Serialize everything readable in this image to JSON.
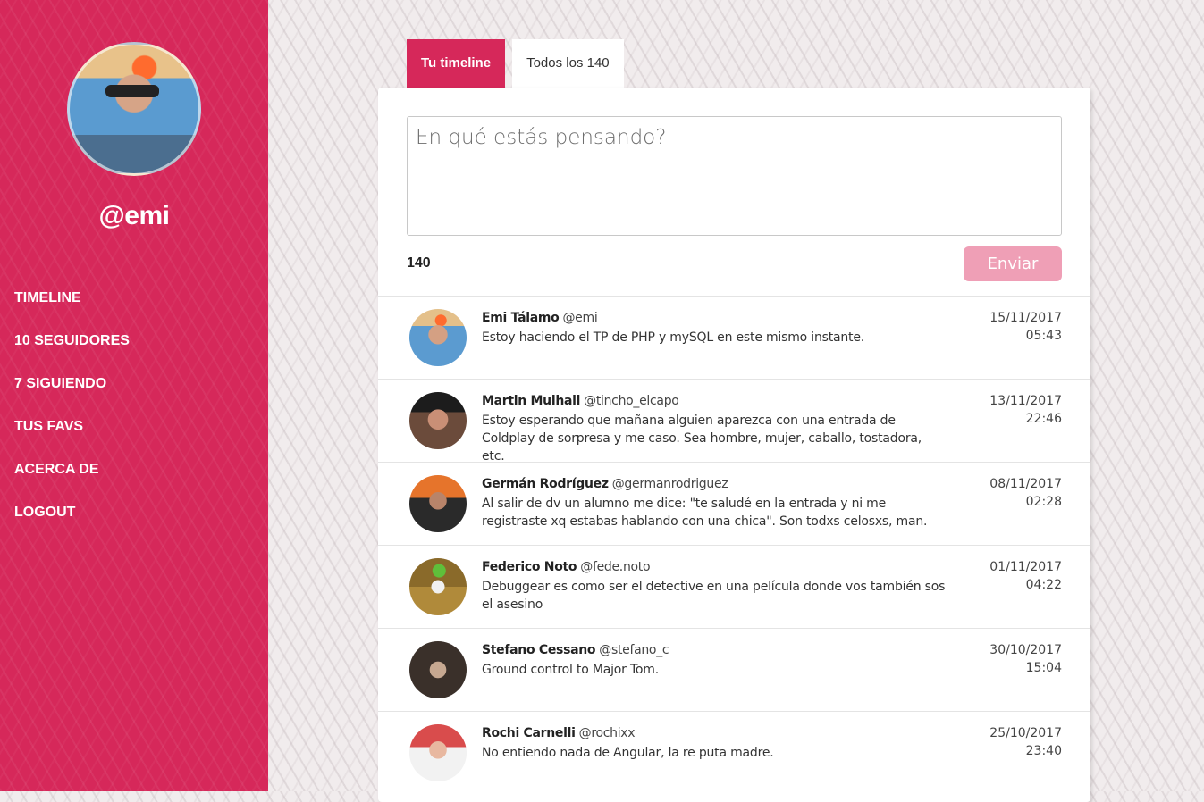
{
  "sidebar": {
    "username": "@emi",
    "nav": [
      {
        "label": "TIMELINE"
      },
      {
        "label": "10 SEGUIDORES"
      },
      {
        "label": "7 SIGUIENDO"
      },
      {
        "label": "TUS FAVS"
      },
      {
        "label": "ACERCA DE"
      },
      {
        "label": "LOGOUT"
      }
    ]
  },
  "tabs": [
    {
      "label": "Tu timeline",
      "active": true
    },
    {
      "label": "Todos los 140",
      "active": false
    }
  ],
  "compose": {
    "placeholder": "En qué estás pensando?",
    "char_count": "140",
    "send_label": "Enviar"
  },
  "colors": {
    "accent": "#d6285a",
    "send_disabled": "#ef9fb6"
  },
  "posts": [
    {
      "name": "Emi Tálamo",
      "handle": "@emi",
      "text": "Estoy haciendo el TP de PHP y mySQL en este mismo instante.",
      "date": "15/11/2017",
      "time": "05:43"
    },
    {
      "name": "Martin Mulhall",
      "handle": "@tincho_elcapo",
      "text": "Estoy esperando que mañana alguien aparezca con una entrada de Coldplay de sorpresa y me caso. Sea hombre, mujer, caballo, tostadora, etc.",
      "date": "13/11/2017",
      "time": "22:46"
    },
    {
      "name": "Germán Rodríguez",
      "handle": "@germanrodriguez",
      "text": "Al salir de dv un alumno me dice: \"te saludé en la entrada y ni me registraste xq estabas hablando con una chica\". Son todxs celosxs, man.",
      "date": "08/11/2017",
      "time": "02:28"
    },
    {
      "name": "Federico Noto",
      "handle": "@fede.noto",
      "text": "Debuggear es como ser el detective en una película donde vos también sos el asesino",
      "date": "01/11/2017",
      "time": "04:22"
    },
    {
      "name": "Stefano Cessano",
      "handle": "@stefano_c",
      "text": "Ground control to Major Tom.",
      "date": "30/10/2017",
      "time": "15:04"
    },
    {
      "name": "Rochi Carnelli",
      "handle": "@rochixx",
      "text": "No entiendo nada de Angular, la re puta madre.",
      "date": "25/10/2017",
      "time": "23:40"
    }
  ]
}
